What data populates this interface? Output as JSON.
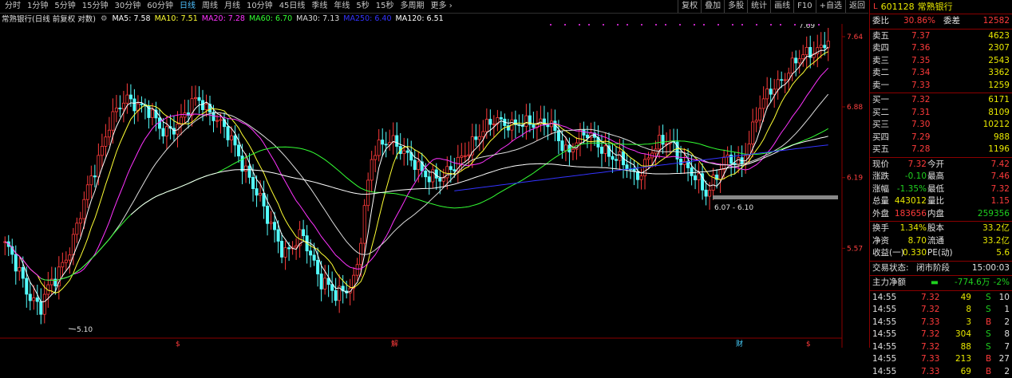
{
  "toolbar": {
    "periods": [
      {
        "label": "分时",
        "active": false
      },
      {
        "label": "1分钟",
        "active": false
      },
      {
        "label": "5分钟",
        "active": false
      },
      {
        "label": "15分钟",
        "active": false
      },
      {
        "label": "30分钟",
        "active": false
      },
      {
        "label": "60分钟",
        "active": false
      },
      {
        "label": "日线",
        "active": true
      },
      {
        "label": "周线",
        "active": false
      },
      {
        "label": "月线",
        "active": false
      },
      {
        "label": "10分钟",
        "active": false
      },
      {
        "label": "45日线",
        "active": false
      },
      {
        "label": "季线",
        "active": false
      },
      {
        "label": "年线",
        "active": false
      },
      {
        "label": "5秒",
        "active": false
      },
      {
        "label": "15秒",
        "active": false
      },
      {
        "label": "多周期",
        "active": false
      },
      {
        "label": "更多 ›",
        "active": false
      }
    ],
    "tools": [
      "复权",
      "叠加",
      "多股",
      "统计",
      "画线",
      "F10",
      "+自选",
      "返回"
    ]
  },
  "legend": {
    "title": "常熟银行(日线 前复权 对数)",
    "mas": [
      {
        "label": "MA5: 7.58",
        "color": "#ffffff"
      },
      {
        "label": "MA10: 7.51",
        "color": "#ffff33"
      },
      {
        "label": "MA20: 7.28",
        "color": "#ff33ff"
      },
      {
        "label": "MA60: 6.70",
        "color": "#33ff33"
      },
      {
        "label": "MA30: 7.13",
        "color": "#dddddd"
      },
      {
        "label": "MA250: 6.40",
        "color": "#3333ff"
      },
      {
        "label": "MA120: 6.51",
        "color": "#ffffff"
      }
    ]
  },
  "chart_data": {
    "type": "candlestick",
    "y_axis_ticks": [
      "7.64",
      "6.88",
      "6.19",
      "5.57"
    ],
    "annotations": {
      "low_label": "5.10",
      "high_label": "7.69",
      "range_label": "6.07 - 6.10"
    },
    "bottom_markers": [
      "$",
      "解",
      "财",
      "$"
    ],
    "anchors_close": [
      5.6,
      5.3,
      5.1,
      5.35,
      5.7,
      6.2,
      6.75,
      6.95,
      6.9,
      6.6,
      6.75,
      6.95,
      6.8,
      6.5,
      6.2,
      5.8,
      5.55,
      5.65,
      5.35,
      5.15,
      5.35,
      6.4,
      6.6,
      6.35,
      6.25,
      6.15,
      6.4,
      6.55,
      6.8,
      6.65,
      6.75,
      6.7,
      6.45,
      6.6,
      6.5,
      6.35,
      6.2,
      6.45,
      6.55,
      6.25,
      6.05,
      6.35,
      6.3,
      6.85,
      7.1,
      7.35,
      7.45,
      7.62
    ],
    "ma_series_names": [
      "MA5",
      "MA10",
      "MA20",
      "MA60",
      "MA30",
      "MA250",
      "MA120"
    ],
    "ma_colors": {
      "MA5": "#ffffff",
      "MA10": "#ffff33",
      "MA20": "#ff33ff",
      "MA60": "#33ff33",
      "MA30": "#dddddd",
      "MA250": "#3333ff",
      "MA120": "#ffffff"
    }
  },
  "panel": {
    "code": "601128",
    "name": "常熟银行",
    "weibi": {
      "label": "委比",
      "value": "30.86%",
      "diff_label": "委差",
      "diff": "12582"
    },
    "sells": [
      {
        "label": "卖五",
        "price": "7.37",
        "vol": "4623"
      },
      {
        "label": "卖四",
        "price": "7.36",
        "vol": "2307"
      },
      {
        "label": "卖三",
        "price": "7.35",
        "vol": "2543"
      },
      {
        "label": "卖二",
        "price": "7.34",
        "vol": "3362"
      },
      {
        "label": "卖一",
        "price": "7.33",
        "vol": "1259"
      }
    ],
    "buys": [
      {
        "label": "买一",
        "price": "7.32",
        "vol": "6171"
      },
      {
        "label": "买二",
        "price": "7.31",
        "vol": "8109"
      },
      {
        "label": "买三",
        "price": "7.30",
        "vol": "10212"
      },
      {
        "label": "买四",
        "price": "7.29",
        "vol": "988"
      },
      {
        "label": "买五",
        "price": "7.28",
        "vol": "1196"
      }
    ],
    "quote": [
      {
        "l1": "现价",
        "v1": "7.32",
        "l2": "今开",
        "v2": "7.42",
        "c1": "red",
        "c2": "red"
      },
      {
        "l1": "涨跌",
        "v1": "-0.10",
        "l2": "最高",
        "v2": "7.46",
        "c1": "green",
        "c2": "red"
      },
      {
        "l1": "涨幅",
        "v1": "-1.35%",
        "l2": "最低",
        "v2": "7.32",
        "c1": "green",
        "c2": "red"
      },
      {
        "l1": "总量",
        "v1": "443012",
        "l2": "量比",
        "v2": "1.15",
        "c1": "yellow",
        "c2": "red"
      },
      {
        "l1": "外盘",
        "v1": "183656",
        "l2": "内盘",
        "v2": "259356",
        "c1": "red",
        "c2": "green"
      }
    ],
    "stats": [
      {
        "l1": "换手",
        "v1": "1.34%",
        "l2": "股本",
        "v2": "33.2亿"
      },
      {
        "l1": "净资",
        "v1": "8.70",
        "l2": "流通",
        "v2": "33.2亿"
      },
      {
        "l1": "收益(一)",
        "v1": "0.330",
        "l2": "PE(动)",
        "v2": "5.6"
      }
    ],
    "trade_state": {
      "label": "交易状态:",
      "value": "闭市阶段",
      "time": "15:00:03"
    },
    "main_flow": {
      "label": "主力净额",
      "value": "-774.6万",
      "pct": "-2%"
    },
    "ticks": [
      {
        "t": "14:55",
        "p": "7.32",
        "v": "49",
        "bs": "S",
        "n": "10"
      },
      {
        "t": "14:55",
        "p": "7.32",
        "v": "8",
        "bs": "S",
        "n": "1"
      },
      {
        "t": "14:55",
        "p": "7.33",
        "v": "3",
        "bs": "B",
        "n": "2"
      },
      {
        "t": "14:55",
        "p": "7.32",
        "v": "304",
        "bs": "S",
        "n": "8"
      },
      {
        "t": "14:55",
        "p": "7.32",
        "v": "88",
        "bs": "S",
        "n": "7"
      },
      {
        "t": "14:55",
        "p": "7.33",
        "v": "213",
        "bs": "B",
        "n": "27"
      },
      {
        "t": "14:55",
        "p": "7.33",
        "v": "69",
        "bs": "B",
        "n": "2"
      }
    ]
  }
}
